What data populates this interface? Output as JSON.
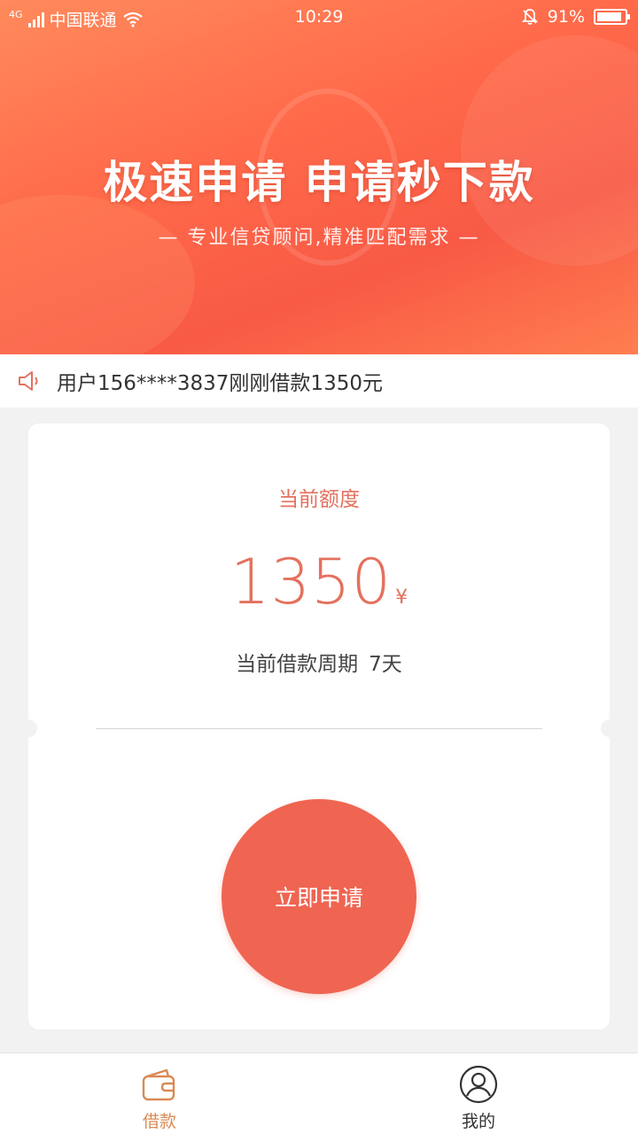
{
  "status_bar": {
    "network": "4G",
    "carrier": "中国联通",
    "time": "10:29",
    "battery": "91%",
    "battery_level": 0.91
  },
  "banner": {
    "title": "极速申请 申请秒下款",
    "subtitle": "— 专业信贷顾问,精准匹配需求 —"
  },
  "notice": {
    "text": "用户156****3837刚刚借款1350元"
  },
  "card": {
    "label": "当前额度",
    "amount": "1350",
    "currency": "¥",
    "period_label": "当前借款周期",
    "period_value": "7天",
    "apply_button": "立即申请"
  },
  "tabbar": {
    "tabs": [
      {
        "label": "借款",
        "icon": "wallet-icon",
        "active": true
      },
      {
        "label": "我的",
        "icon": "user-icon",
        "active": false
      }
    ]
  },
  "colors": {
    "accent": "#ef6552",
    "accent_text": "#e4715e",
    "tab_active": "#d98a55"
  }
}
